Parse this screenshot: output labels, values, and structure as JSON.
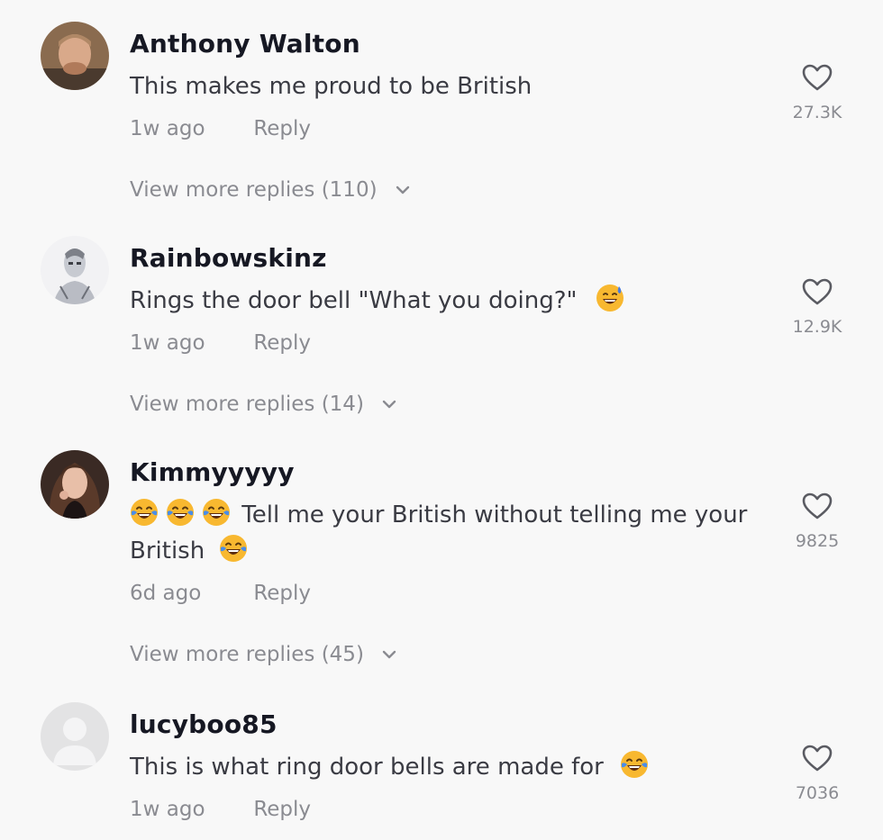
{
  "comments": [
    {
      "username": "Anthony Walton",
      "text": "This makes me proud to be British",
      "time": "1w ago",
      "reply_label": "Reply",
      "likes": "27.3K",
      "view_replies": "View more replies (110)"
    },
    {
      "username": "Rainbowskinz",
      "text": "Rings the door bell \"What you doing?\"",
      "emoji_after": "sweat-smile-emoji",
      "time": "1w ago",
      "reply_label": "Reply",
      "likes": "12.9K",
      "view_replies": "View more replies (14)"
    },
    {
      "username": "Kimmyyyyy",
      "text_line1": "Tell me your British without telling me your",
      "text_line2": "British",
      "emoji_before": [
        "joy-emoji",
        "joy-emoji",
        "joy-emoji"
      ],
      "emoji_after": "joy-emoji",
      "time": "6d ago",
      "reply_label": "Reply",
      "likes": "9825",
      "view_replies": "View more replies (45)"
    },
    {
      "username": "lucyboo85",
      "text": "This is what ring door bells are made for",
      "emoji_after": "joy-emoji",
      "time": "1w ago",
      "reply_label": "Reply",
      "likes": "7036"
    }
  ],
  "icons": {
    "like": "heart-outline-icon",
    "expand": "chevron-down-icon"
  },
  "colors": {
    "background": "#f8f8f8",
    "username": "#161823",
    "text": "#3a3b43",
    "secondary": "#8a8b91"
  }
}
